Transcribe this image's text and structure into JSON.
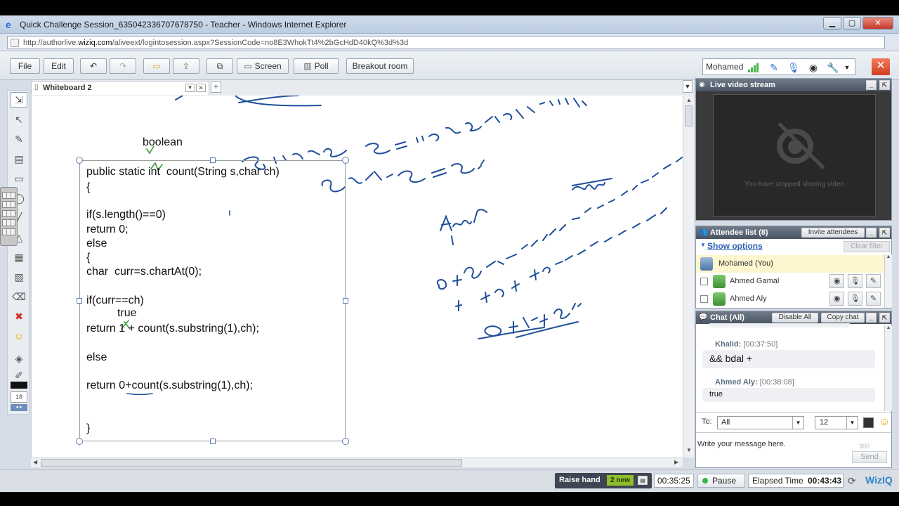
{
  "browser": {
    "title": "Quick Challenge Session_635042336707678750 - Teacher - Windows Internet Explorer",
    "url_prefix": "http://authorlive.",
    "url_domain": "wiziq.com",
    "url_rest": "/aliveext/logintosession.aspx?SessionCode=no8E3WhokTt4%2bGcHdD40kQ%3d%3d"
  },
  "toolbar": {
    "file": "File",
    "edit": "Edit",
    "screen": "Screen",
    "poll": "Poll",
    "breakout": "Breakout room",
    "user": "Mohamed",
    "exit": "✕"
  },
  "whiteboard": {
    "tab_label": "Whiteboard 2",
    "code_lines": [
      "public static int  count(String s,char ch)",
      "{",
      "",
      "if(s.length()==0)",
      "return 0;",
      "else",
      "{",
      "char  curr=s.chartAt(0);",
      "",
      "if(curr==ch)",
      "true",
      "return 1 + count(s.substring(1),ch);",
      "",
      "else",
      "",
      "return 0+count(s.substring(1),ch);",
      "",
      "",
      "}"
    ],
    "annotation_boolean": "boolean"
  },
  "video": {
    "title": "Live video stream",
    "message": "You have stopped sharing video"
  },
  "attendees": {
    "title": "Attendee list (8)",
    "invite": "Invite attendees",
    "show_options": "Show options",
    "clear_filter": "Clear filter",
    "items": [
      {
        "name": "Mohamed (You)"
      },
      {
        "name": "Ahmed Gamal"
      },
      {
        "name": "Ahmed Aly"
      }
    ]
  },
  "chat": {
    "title": "Chat (All)",
    "disable_all": "Disable All",
    "copy_chat": "Copy chat",
    "messages": [
      {
        "author": "Khalid:",
        "time": "[00:37:50]",
        "text": "&& bdal +"
      },
      {
        "author": "Ahmed Aly:",
        "time": "[00:38:08]",
        "text": "true"
      }
    ],
    "to_label": "To:",
    "to_value": "All",
    "font_size": "12",
    "placeholder": "Write your message here.",
    "char_count": "300",
    "send": "Send"
  },
  "status": {
    "raise_hand": "Raise hand",
    "new_count": "2 new",
    "time": "00:35:25",
    "pause": "Pause",
    "elapsed_label": "Elapsed Time",
    "elapsed_value": "00:43:43",
    "logo": "WizIQ"
  },
  "left_tools": {
    "font_size": "18"
  },
  "colors": {
    "ink_blue": "#1f4f9a",
    "ink_green": "#3a9a3a",
    "panel_header": "#56606e",
    "new_badge": "#8fbe2a"
  }
}
